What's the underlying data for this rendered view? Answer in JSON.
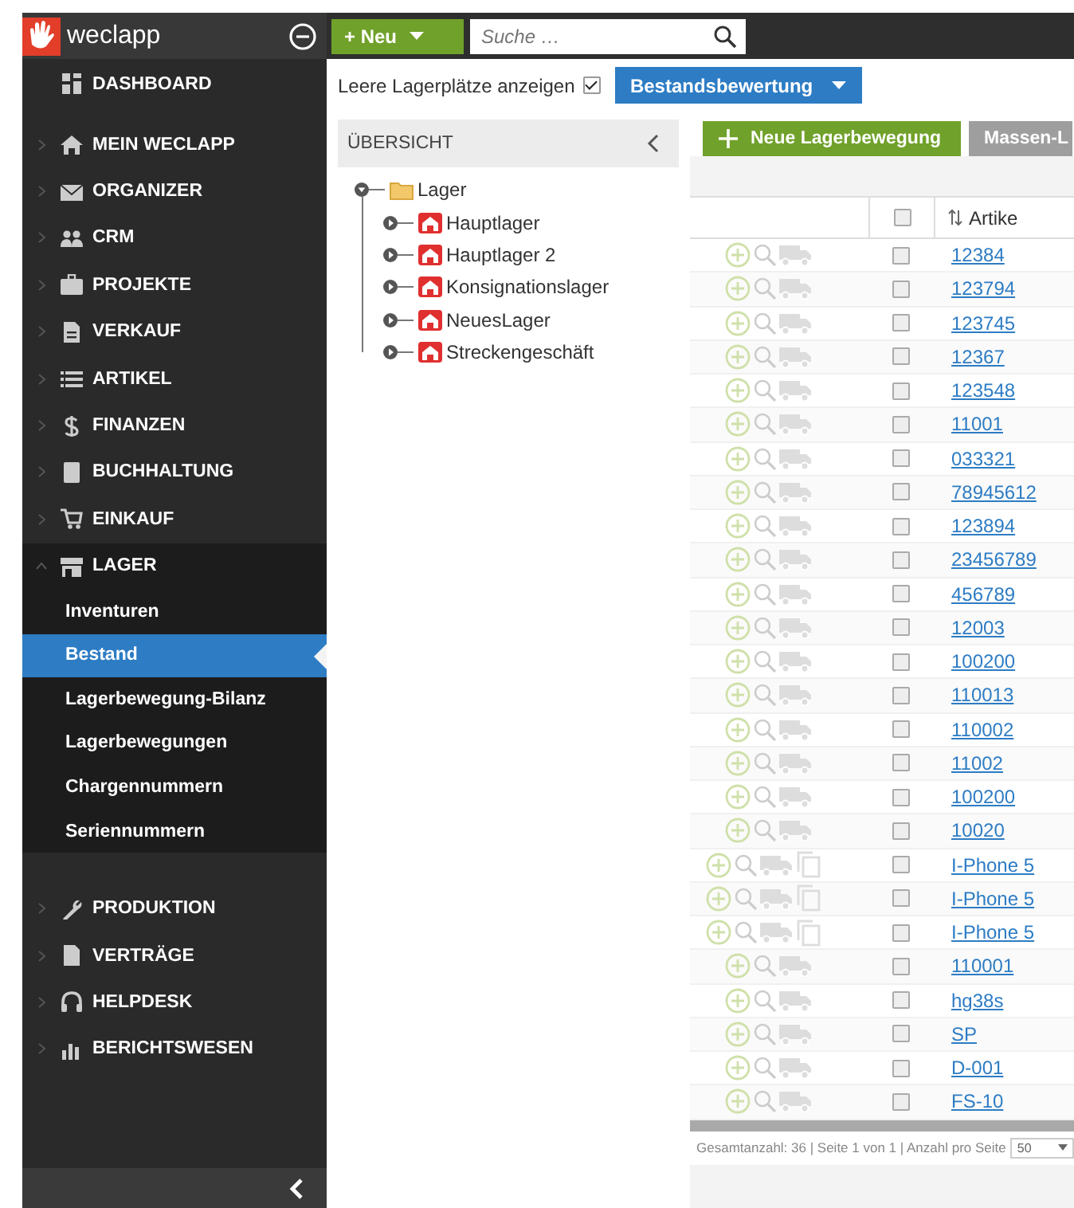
{
  "app": {
    "logo_text": "weclapp"
  },
  "topbar": {
    "new_button": "+ Neu",
    "search": {
      "placeholder": "Suche …"
    }
  },
  "sidebar": {
    "items": [
      {
        "label": "DASHBOARD",
        "has_chevron": false
      },
      {
        "label": "MEIN WECLAPP",
        "expanded": false,
        "has_chevron": true
      },
      {
        "label": "ORGANIZER",
        "expanded": false,
        "has_chevron": true
      },
      {
        "label": "CRM",
        "expanded": false,
        "has_chevron": true
      },
      {
        "label": "PROJEKTE",
        "expanded": false,
        "has_chevron": true
      },
      {
        "label": "VERKAUF",
        "expanded": false,
        "has_chevron": true
      },
      {
        "label": "ARTIKEL",
        "expanded": false,
        "has_chevron": true
      },
      {
        "label": "FINANZEN",
        "expanded": false,
        "has_chevron": true
      },
      {
        "label": "BUCHHALTUNG",
        "expanded": false,
        "has_chevron": true
      },
      {
        "label": "EINKAUF",
        "expanded": false,
        "has_chevron": true
      },
      {
        "label": "LAGER",
        "expanded": true,
        "has_chevron": true,
        "children": [
          {
            "label": "Inventuren",
            "selected": false
          },
          {
            "label": "Bestand",
            "selected": true
          },
          {
            "label": "Lagerbewegung-Bilanz",
            "selected": false
          },
          {
            "label": "Lagerbewegungen",
            "selected": false
          },
          {
            "label": "Chargennummern",
            "selected": false
          },
          {
            "label": "Seriennummern",
            "selected": false
          }
        ]
      },
      {
        "label": "PRODUKTION",
        "expanded": false,
        "has_chevron": true
      },
      {
        "label": "VERTRÄGE",
        "expanded": false,
        "has_chevron": true
      },
      {
        "label": "HELPDESK",
        "expanded": false,
        "has_chevron": true
      },
      {
        "label": "BERICHTSWESEN",
        "expanded": false,
        "has_chevron": true
      }
    ]
  },
  "toolbar": {
    "empty_slots": {
      "label": "Leere Lagerplätze anzeigen",
      "checked": true
    },
    "valuation_button": "Bestandsbewertung"
  },
  "tree": {
    "title": "ÜBERSICHT",
    "nodes": [
      {
        "label": "Lager",
        "expanded": true,
        "children": [
          {
            "label": "Hauptlager",
            "expanded": false
          },
          {
            "label": "Hauptlager 2",
            "expanded": false
          },
          {
            "label": "Konsignationslager",
            "expanded": false
          },
          {
            "label": "NeuesLager",
            "expanded": false
          },
          {
            "label": "Streckengeschäft",
            "expanded": false
          }
        ]
      }
    ]
  },
  "grid": {
    "buttons": [
      {
        "label": "Neue Lagerbewegung",
        "kind": "primary"
      },
      {
        "label": "Massen-L",
        "kind": "disabled"
      }
    ],
    "header": {
      "checked": false,
      "column_2": "Artike"
    },
    "rows": [
      {
        "kind": "simple",
        "checked": false,
        "column_2": "12384"
      },
      {
        "kind": "simple",
        "checked": false,
        "column_2": "123794"
      },
      {
        "kind": "simple",
        "checked": false,
        "column_2": "123745"
      },
      {
        "kind": "simple",
        "checked": false,
        "column_2": "12367"
      },
      {
        "kind": "simple",
        "checked": false,
        "column_2": "123548"
      },
      {
        "kind": "simple",
        "checked": false,
        "column_2": "11001"
      },
      {
        "kind": "simple",
        "checked": false,
        "column_2": "033321"
      },
      {
        "kind": "simple",
        "checked": false,
        "column_2": "78945612"
      },
      {
        "kind": "simple",
        "checked": false,
        "column_2": "123894"
      },
      {
        "kind": "simple",
        "checked": false,
        "column_2": "23456789"
      },
      {
        "kind": "simple",
        "checked": false,
        "column_2": "456789"
      },
      {
        "kind": "simple",
        "checked": false,
        "column_2": "12003"
      },
      {
        "kind": "simple",
        "checked": false,
        "column_2": "100200"
      },
      {
        "kind": "simple",
        "checked": false,
        "column_2": "110013"
      },
      {
        "kind": "simple",
        "checked": false,
        "column_2": "110002"
      },
      {
        "kind": "simple",
        "checked": false,
        "column_2": "11002"
      },
      {
        "kind": "simple",
        "checked": false,
        "column_2": "100200"
      },
      {
        "kind": "simple",
        "checked": false,
        "column_2": "10020"
      },
      {
        "kind": "variant",
        "checked": false,
        "column_2": "I-Phone 5"
      },
      {
        "kind": "variant",
        "checked": false,
        "column_2": "I-Phone 5"
      },
      {
        "kind": "variant",
        "checked": false,
        "column_2": "I-Phone 5"
      },
      {
        "kind": "simple",
        "checked": false,
        "column_2": "110001"
      },
      {
        "kind": "simple",
        "checked": false,
        "column_2": "hg38s"
      },
      {
        "kind": "simple",
        "checked": false,
        "column_2": "SP"
      },
      {
        "kind": "simple",
        "checked": false,
        "column_2": "D-001"
      },
      {
        "kind": "simple",
        "checked": false,
        "column_2": "FS-10"
      }
    ],
    "footer": {
      "summary": "Gesamtanzahl: 36  |  Seite 1 von 1  |  Anzahl pro Seite",
      "page_size": "50"
    }
  }
}
